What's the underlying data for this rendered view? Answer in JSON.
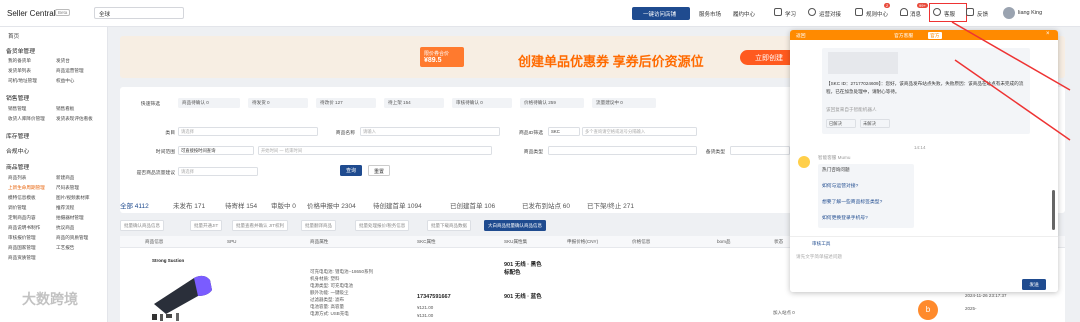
{
  "topbar": {
    "brand": "Seller Central",
    "beta": "Beta",
    "region": "全球",
    "visit_store": "一键访问店铺",
    "nav": [
      "服务市场",
      "履约中心",
      "学习",
      "运营对接",
      "规则中心",
      "消息",
      "客服",
      "反馈"
    ],
    "badges": {
      "rules": "2",
      "messages": "99+"
    },
    "username": "liang King"
  },
  "sidebar": {
    "home": "首页",
    "groups": [
      {
        "title": "备货单管理",
        "items": [
          "我的备货单",
          "发货台",
          "发货单列表",
          "商品运营管理",
          "司机/地址管理",
          "权益中心"
        ]
      },
      {
        "title": "销售管理",
        "items": [
          "销售管理",
          "销售看板",
          "收货人库降价管理",
          "发货表现评估看板"
        ]
      },
      {
        "title": "库存管理",
        "items": []
      },
      {
        "title": "合规中心",
        "items": []
      },
      {
        "title": "商品管理",
        "items": [
          "商品列表",
          "新建商品",
          "上新生命周期管理",
          "尺码表管理",
          "模特信息模板",
          "图片/视频素材库",
          "调价管理",
          "推荐流程",
          "定制商品内容",
          "拍摄器材管理",
          "商品说明书制作",
          "抗议商品",
          "审核报价管理",
          "商品的资质管理",
          "商品国家管理",
          "工艺报告",
          "商品资质管理"
        ]
      }
    ]
  },
  "banner": {
    "tag_title": "限价券合价",
    "tag_price": "¥89.5",
    "title": "创建单品优惠券 享券后价资源位",
    "button": "立即创建"
  },
  "filters": {
    "quick": {
      "label": "快速筛选",
      "pills": [
        "商品待确认 0",
        "待发货 0",
        "待改价 127",
        "待上架 154",
        "审核待确认 0",
        "价格待确认 259",
        "流量建议中 0"
      ]
    },
    "rows": [
      {
        "label": "类目",
        "placeholder": "请选择"
      },
      {
        "label": "商品名称",
        "placeholder": "请输入"
      },
      {
        "label": "商品ID筛选",
        "select": "SKC",
        "placeholder": "多个查询请空格或逗号分隔输入"
      },
      {
        "label": "时间范围",
        "select": "可直接按时间查询",
        "placeholder": "开始时间 一 结束时间"
      },
      {
        "label": "商品类型",
        "placeholder": ""
      },
      {
        "label": "备货类型",
        "placeholder": ""
      },
      {
        "label": "是否商品流量建议",
        "placeholder": "请选择"
      }
    ],
    "query": "查询",
    "reset": "重置"
  },
  "tabs": [
    "全部 4112",
    "未发布 171",
    "待寄样 154",
    "审版中 0",
    "价格申报中 2304",
    "待创建首单 1094",
    "已创建首单 106",
    "已发布到站点 60",
    "已下架/终止 271"
  ],
  "bulk_actions": [
    "批量确认商品信息",
    "批量开通JIT",
    "批量查看并确认 JIT权利",
    "批量翻译商品",
    "批量处理报价/税务信息",
    "批量下载商品数据",
    "大白商品批量确认商品信息"
  ],
  "table": {
    "headers": [
      "商品信息",
      "SPU",
      "商品属性",
      "SKC属性",
      "SKU属性集",
      "申报价格(CNY)",
      "价格信息",
      "bom品",
      "状态"
    ],
    "row": {
      "product_label": "Strong Suction",
      "attrs": [
        "可充电电池: 锂电池--18650系列",
        "机身材质: 塑料",
        "电源类型: 可充电电池",
        "额外功能: 一键吸尘",
        "过滤器类型: 滤布",
        "电池容量: 高容量",
        "电源方式: USB充电"
      ],
      "skc_id": "17347591667",
      "sku_attrs": [
        "901 无线 · 黑色",
        "标配色"
      ],
      "sku_attrs2": "901 无线 · 蓝色",
      "declared_price": "¥121.00",
      "declared_price2": "¥131.00",
      "status_text": "加入站点 0",
      "date": "2024-11-26 23:17:37",
      "date2": "2025-"
    }
  },
  "chat": {
    "header_back": "返回",
    "header_title": "官方客服",
    "header_tag": "官方",
    "skc_message": "【SKC ID：27177024609】：您好，该商品发布站点失败，失败原因：该商品在站点有未完成的流程，已在加急处理中，请耐心等待。",
    "from_agent": "该回复来自于智能机器人",
    "helpful": "已解决",
    "not_helpful": "未解决",
    "time": "14:14",
    "bot_name": "智能客服 Mumu",
    "bot_greeting": "热门咨询问题",
    "faq": [
      "如何与运营对接?",
      "想要了解一些商品标签类型?",
      "如何更换登录手机号?"
    ],
    "input_placeholder": "请先文字简单描述问题",
    "tool": "审核工具",
    "send": "发送"
  },
  "watermark": "大数跨境",
  "orange_btn": "b"
}
